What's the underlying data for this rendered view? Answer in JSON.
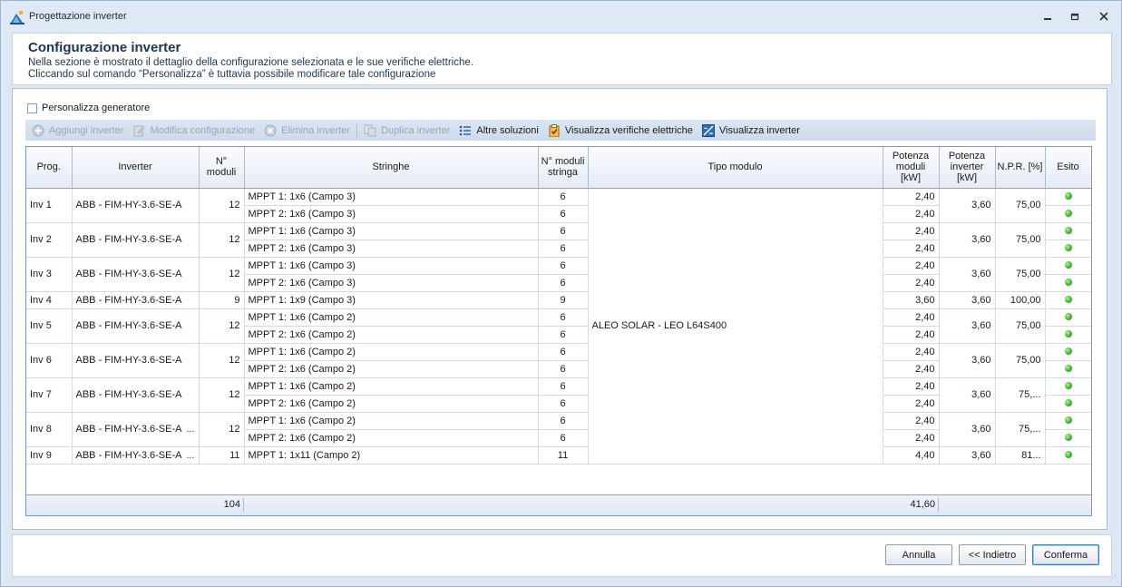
{
  "window": {
    "title": "Progettazione inverter"
  },
  "header": {
    "title": "Configurazione inverter",
    "line1": "Nella sezione è mostrato il dettaglio della configurazione selezionata e le sue verifiche elettriche.",
    "line2": "Cliccando sul comando “Personalizza” è tuttavia possibile modificare tale configurazione"
  },
  "options": {
    "personalizza_label": "Personalizza generatore",
    "personalizza_checked": false
  },
  "toolbar": {
    "aggiungi": "Aggiungi inverter",
    "modifica": "Modifica configurazione",
    "elimina": "Elimina inverter",
    "duplica": "Duplica inverter",
    "altre": "Altre soluzioni",
    "verifiche": "Visualizza verifiche elettriche",
    "visualizza": "Visualizza inverter"
  },
  "grid": {
    "columns": {
      "prog": "Prog.",
      "inverter": "Inverter",
      "n_moduli": "N° moduli",
      "stringhe": "Stringhe",
      "n_moduli_stringa": "N° moduli stringa",
      "tipo_modulo": "Tipo modulo",
      "potenza_moduli": "Potenza moduli [kW]",
      "potenza_inverter": "Potenza inverter [kW]",
      "npr": "N.P.R. [%]",
      "esito": "Esito"
    },
    "tipo_modulo": "ALEO SOLAR - LEO L64S400",
    "rows": [
      {
        "prog": "Inv 1",
        "inverter": "ABB - FIM-HY-3.6-SE-A",
        "ell": "",
        "n_moduli": "12",
        "pot_inv": "3,60",
        "npr": "75,00",
        "strings": [
          {
            "s": "MPPT 1: 1x6 (Campo 3)",
            "n": "6",
            "p": "2,40"
          },
          {
            "s": "MPPT 2: 1x6 (Campo 3)",
            "n": "6",
            "p": "2,40"
          }
        ]
      },
      {
        "prog": "Inv 2",
        "inverter": "ABB - FIM-HY-3.6-SE-A",
        "ell": "",
        "n_moduli": "12",
        "pot_inv": "3,60",
        "npr": "75,00",
        "strings": [
          {
            "s": "MPPT 1: 1x6 (Campo 3)",
            "n": "6",
            "p": "2,40"
          },
          {
            "s": "MPPT 2: 1x6 (Campo 3)",
            "n": "6",
            "p": "2,40"
          }
        ]
      },
      {
        "prog": "Inv 3",
        "inverter": "ABB - FIM-HY-3.6-SE-A",
        "ell": "",
        "n_moduli": "12",
        "pot_inv": "3,60",
        "npr": "75,00",
        "strings": [
          {
            "s": "MPPT 1: 1x6 (Campo 3)",
            "n": "6",
            "p": "2,40"
          },
          {
            "s": "MPPT 2: 1x6 (Campo 3)",
            "n": "6",
            "p": "2,40"
          }
        ]
      },
      {
        "prog": "Inv 4",
        "inverter": "ABB - FIM-HY-3.6-SE-A",
        "ell": "",
        "n_moduli": "9",
        "pot_inv": "3,60",
        "npr": "100,00",
        "strings": [
          {
            "s": "MPPT 1: 1x9 (Campo 3)",
            "n": "9",
            "p": "3,60"
          }
        ]
      },
      {
        "prog": "Inv 5",
        "inverter": "ABB - FIM-HY-3.6-SE-A",
        "ell": "",
        "n_moduli": "12",
        "pot_inv": "3,60",
        "npr": "75,00",
        "strings": [
          {
            "s": "MPPT 1: 1x6 (Campo 2)",
            "n": "6",
            "p": "2,40"
          },
          {
            "s": "MPPT 2: 1x6 (Campo 2)",
            "n": "6",
            "p": "2,40"
          }
        ]
      },
      {
        "prog": "Inv 6",
        "inverter": "ABB - FIM-HY-3.6-SE-A",
        "ell": "",
        "n_moduli": "12",
        "pot_inv": "3,60",
        "npr": "75,00",
        "strings": [
          {
            "s": "MPPT 1: 1x6 (Campo 2)",
            "n": "6",
            "p": "2,40"
          },
          {
            "s": "MPPT 2: 1x6 (Campo 2)",
            "n": "6",
            "p": "2,40"
          }
        ]
      },
      {
        "prog": "Inv 7",
        "inverter": "ABB - FIM-HY-3.6-SE-A",
        "ell": "",
        "n_moduli": "12",
        "pot_inv": "3,60",
        "npr": "75,...",
        "strings": [
          {
            "s": "MPPT 1: 1x6 (Campo 2)",
            "n": "6",
            "p": "2,40"
          },
          {
            "s": "MPPT 2: 1x6 (Campo 2)",
            "n": "6",
            "p": "2,40"
          }
        ]
      },
      {
        "prog": "Inv 8",
        "inverter": "ABB - FIM-HY-3.6-SE-A",
        "ell": "...",
        "n_moduli": "12",
        "pot_inv": "3,60",
        "npr": "75,...",
        "strings": [
          {
            "s": "MPPT 1: 1x6 (Campo 2)",
            "n": "6",
            "p": "2,40"
          },
          {
            "s": "MPPT 2: 1x6 (Campo 2)",
            "n": "6",
            "p": "2,40"
          }
        ]
      },
      {
        "prog": "Inv 9",
        "inverter": "ABB - FIM-HY-3.6-SE-A",
        "ell": "...",
        "n_moduli": "11",
        "pot_inv": "3,60",
        "npr": "81...",
        "strings": [
          {
            "s": "MPPT 1: 1x11 (Campo 2)",
            "n": "11",
            "p": "4,40"
          }
        ]
      }
    ],
    "totals": {
      "n_moduli": "104",
      "potenza_moduli": "41,60"
    }
  },
  "buttons": {
    "annulla": "Annulla",
    "indietro": "<< Indietro",
    "conferma": "Conferma"
  },
  "colors": {
    "esito_ok": "#4fc23a",
    "accent": "#1d3557"
  }
}
